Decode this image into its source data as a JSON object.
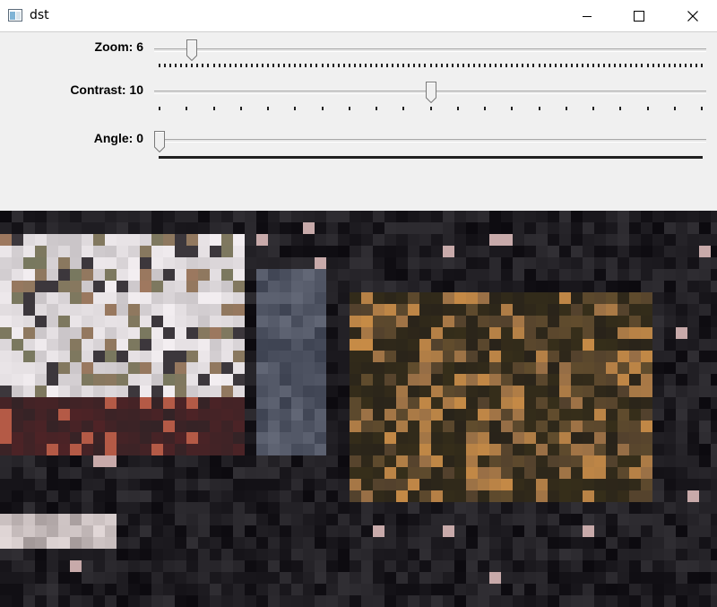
{
  "window": {
    "title": "dst",
    "controls": {
      "minimize": "minimize-icon",
      "maximize": "maximize-icon",
      "close": "close-icon"
    }
  },
  "trackbars": [
    {
      "name": "Zoom",
      "label": "Zoom: 6",
      "value": 6,
      "max": 100
    },
    {
      "name": "Contrast",
      "label": "Contrast: 10",
      "value": 10,
      "max": 20
    },
    {
      "name": "Angle",
      "label": "Angle: 0",
      "value": 0,
      "max": 360
    }
  ],
  "image": {
    "description": "",
    "palette": [
      "#15141a",
      "#0c0b10",
      "#1f1d22",
      "#2b2a2f",
      "#3a3537",
      "#4d4340",
      "#6b5a4a",
      "#8a6a45",
      "#a07a4a",
      "#c79a5a",
      "#dcd8dc",
      "#f2eef0",
      "#bfbbbf",
      "#7a7d6a",
      "#5a6070",
      "#b8483a",
      "#e46a4a"
    ]
  },
  "colors": {
    "panel": "#f0f0f0",
    "titlebar": "#ffffff",
    "track": "#e6e6e6",
    "tick": "#202020"
  }
}
